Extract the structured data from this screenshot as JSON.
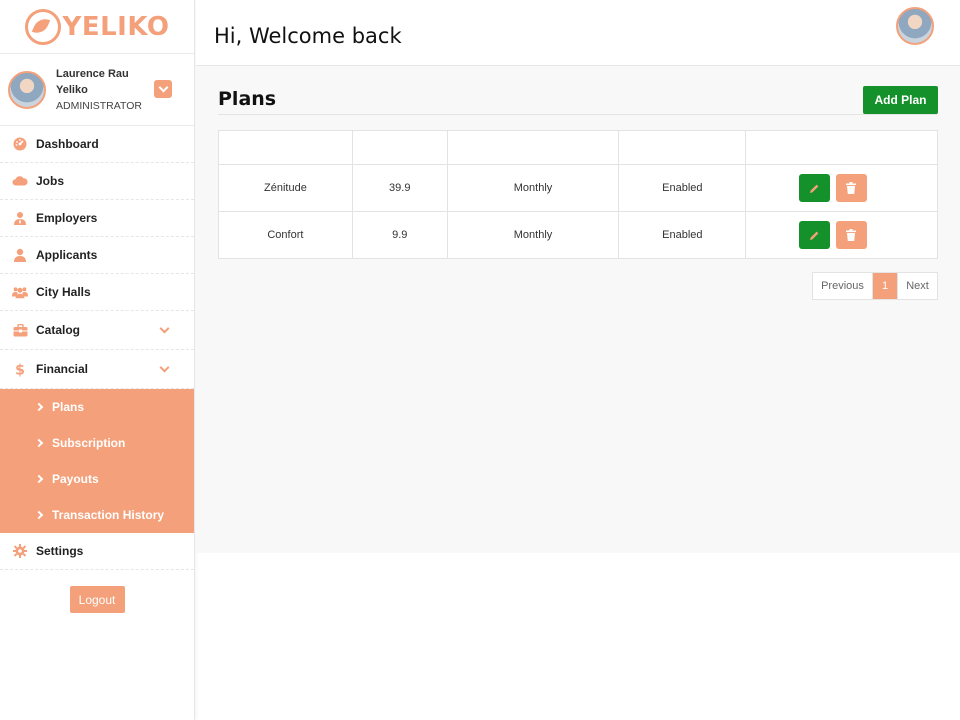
{
  "brand": {
    "name": "YELIKO",
    "accent": "#f4a07a",
    "green": "#15912b"
  },
  "profile": {
    "name": "Laurence Rau Yeliko",
    "role": "ADMINISTRATOR"
  },
  "nav": [
    {
      "label": "Dashboard",
      "icon": "dashboard-icon"
    },
    {
      "label": "Jobs",
      "icon": "cloud-icon"
    },
    {
      "label": "Employers",
      "icon": "user-tie-icon"
    },
    {
      "label": "Applicants",
      "icon": "user-icon"
    },
    {
      "label": "City Halls",
      "icon": "users-icon"
    },
    {
      "label": "Catalog",
      "icon": "briefcase-icon"
    },
    {
      "label": "Financial",
      "icon": "dollar-icon"
    }
  ],
  "financial_sub": [
    "Plans",
    "Subscription",
    "Payouts",
    "Transaction History"
  ],
  "settings": {
    "label": "Settings",
    "icon": "gear-icon"
  },
  "logout_label": "Logout",
  "header": {
    "welcome": "Hi, Welcome back"
  },
  "main": {
    "title": "Plans",
    "add_button": "Add Plan",
    "table": {
      "rows": [
        {
          "name": "Zénitude",
          "price": "39.9",
          "period": "Monthly",
          "status": "Enabled"
        },
        {
          "name": "Confort",
          "price": "9.9",
          "period": "Monthly",
          "status": "Enabled"
        }
      ]
    },
    "pagination": {
      "prev": "Previous",
      "page": "1",
      "next": "Next"
    }
  }
}
